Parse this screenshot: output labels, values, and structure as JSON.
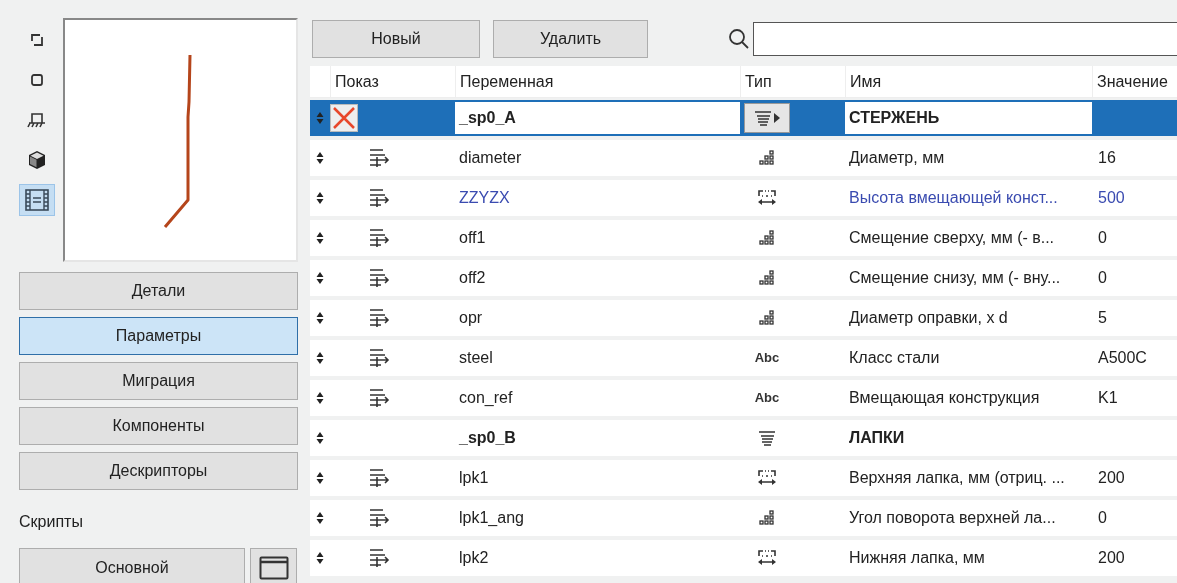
{
  "view_modes": [
    {
      "kind": "frame",
      "selected": false
    },
    {
      "kind": "square",
      "selected": false
    },
    {
      "kind": "support",
      "selected": false
    },
    {
      "kind": "cube",
      "selected": false
    },
    {
      "kind": "film",
      "selected": true
    }
  ],
  "sections": [
    {
      "label": "Детали",
      "selected": false
    },
    {
      "label": "Параметры",
      "selected": true
    },
    {
      "label": "Миграция",
      "selected": false
    },
    {
      "label": "Компоненты",
      "selected": false
    },
    {
      "label": "Дескрипторы",
      "selected": false
    }
  ],
  "scripts": {
    "label": "Скрипты",
    "button": "Основной"
  },
  "toolbar": {
    "buttons": [
      "Новый",
      "Удалить"
    ]
  },
  "table": {
    "columns": [
      "Показ",
      "Переменная",
      "Тип",
      "Имя",
      "Значение"
    ],
    "rows": [
      {
        "kind": "group",
        "selected": true,
        "variable": "_sp0_A",
        "type": {
          "kind": "group"
        },
        "name": "СТЕРЖЕНЬ",
        "highlighted": false
      },
      {
        "kind": "param",
        "selected": false,
        "variable": "diameter",
        "type": {
          "kind": "number"
        },
        "name": "Диаметр, мм",
        "value": "16",
        "highlighted": false
      },
      {
        "kind": "param",
        "selected": false,
        "variable": "ZZYZX",
        "type": {
          "kind": "length"
        },
        "name": "Высота вмещающей конст...",
        "value": "500",
        "highlighted": true
      },
      {
        "kind": "param",
        "selected": false,
        "variable": "off1",
        "type": {
          "kind": "number"
        },
        "name": "Смещение сверху, мм (- в...",
        "value": "0",
        "highlighted": false
      },
      {
        "kind": "param",
        "selected": false,
        "variable": "off2",
        "type": {
          "kind": "number"
        },
        "name": "Смещение снизу, мм (- вну...",
        "value": "0",
        "highlighted": false
      },
      {
        "kind": "param",
        "selected": false,
        "variable": "opr",
        "type": {
          "kind": "number"
        },
        "name": "Диаметр оправки, x d",
        "value": "5",
        "highlighted": false
      },
      {
        "kind": "param",
        "selected": false,
        "variable": "steel",
        "type": {
          "kind": "text",
          "label": "Abc"
        },
        "name": "Класс стали",
        "value": "A500C",
        "highlighted": false
      },
      {
        "kind": "param",
        "selected": false,
        "variable": "con_ref",
        "type": {
          "kind": "text",
          "label": "Abc"
        },
        "name": "Вмещающая конструкция",
        "value": "K1",
        "highlighted": false
      },
      {
        "kind": "group",
        "selected": false,
        "variable": "_sp0_B",
        "type": {
          "kind": "group"
        },
        "name": "ЛАПКИ",
        "highlighted": false
      },
      {
        "kind": "param",
        "selected": false,
        "variable": "lpk1",
        "type": {
          "kind": "length"
        },
        "name": "Верхняя лапка, мм (отриц. ...",
        "value": "200",
        "highlighted": false
      },
      {
        "kind": "param",
        "selected": false,
        "variable": "lpk1_ang",
        "type": {
          "kind": "number"
        },
        "name": "Угол поворота верхней ла...",
        "value": "0",
        "highlighted": false
      },
      {
        "kind": "param",
        "selected": false,
        "variable": "lpk2",
        "type": {
          "kind": "length"
        },
        "name": "Нижняя лапка, мм",
        "value": "200",
        "highlighted": false
      }
    ]
  }
}
